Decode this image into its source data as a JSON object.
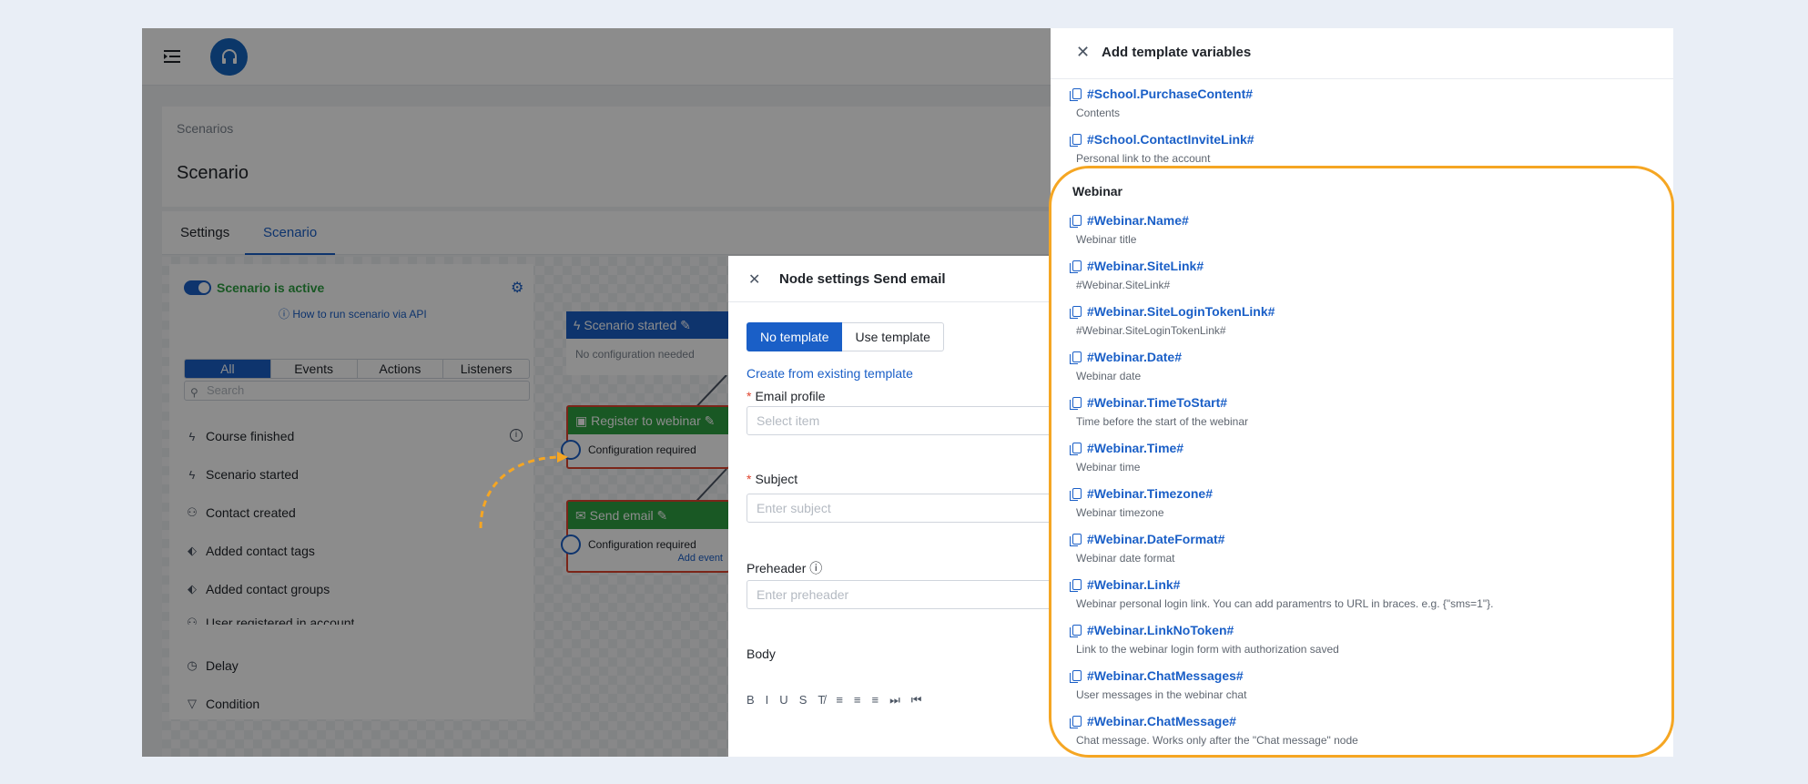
{
  "breadcrumb": "Scenarios",
  "page_title": "Scenario",
  "tabs": [
    {
      "label": "Settings"
    },
    {
      "label": "Scenario"
    }
  ],
  "left_panel": {
    "active_label": "Scenario is active",
    "api_link": "How to run scenario via API",
    "segments": [
      "All",
      "Events",
      "Actions",
      "Listeners"
    ],
    "search_placeholder": "Search",
    "items": [
      {
        "label": "Course finished",
        "icon": "bolt-icon"
      },
      {
        "label": "Scenario started",
        "icon": "bolt-icon"
      },
      {
        "label": "Contact created",
        "icon": "user-icon"
      },
      {
        "label": "Added contact tags",
        "icon": "tag-icon"
      },
      {
        "label": "Added contact groups",
        "icon": "tag-icon"
      },
      {
        "label": "User registered in account",
        "icon": "user-icon"
      },
      {
        "label": "Delay",
        "icon": "clock-icon"
      },
      {
        "label": "Condition",
        "icon": "filter-icon"
      }
    ]
  },
  "nodes": {
    "started": {
      "title": "Scenario started",
      "body": "No configuration needed"
    },
    "register": {
      "title": "Register to webinar",
      "body": "Configuration required"
    },
    "send": {
      "title": "Send email",
      "body": "Configuration required",
      "add_event": "Add event"
    }
  },
  "node_settings": {
    "title": "Node settings Send email",
    "btn_no_template": "No template",
    "btn_use_template": "Use template",
    "create_link": "Create from existing template",
    "email_profile_label": "Email profile",
    "email_profile_placeholder": "Select item",
    "subject_label": "Subject",
    "subject_placeholder": "Enter subject",
    "preheader_label": "Preheader",
    "preheader_placeholder": "Enter preheader",
    "body_label": "Body",
    "toolbar": [
      "B",
      "I",
      "U",
      "S",
      "T̸",
      "≡",
      "≡",
      "≡",
      "⏭",
      "⏮"
    ]
  },
  "drawer": {
    "title": "Add template variables",
    "top_vars": [
      {
        "name": "#School.PurchaseContent#",
        "desc": "Contents"
      },
      {
        "name": "#School.ContactInviteLink#",
        "desc": "Personal link to the account"
      }
    ],
    "section": "Webinar",
    "webinar_vars": [
      {
        "name": "#Webinar.Name#",
        "desc": "Webinar title"
      },
      {
        "name": "#Webinar.SiteLink#",
        "desc": "#Webinar.SiteLink#"
      },
      {
        "name": "#Webinar.SiteLoginTokenLink#",
        "desc": "#Webinar.SiteLoginTokenLink#"
      },
      {
        "name": "#Webinar.Date#",
        "desc": "Webinar date"
      },
      {
        "name": "#Webinar.TimeToStart#",
        "desc": "Time before the start of the webinar"
      },
      {
        "name": "#Webinar.Time#",
        "desc": "Webinar time"
      },
      {
        "name": "#Webinar.Timezone#",
        "desc": "Webinar timezone"
      },
      {
        "name": "#Webinar.DateFormat#",
        "desc": "Webinar date format"
      },
      {
        "name": "#Webinar.Link#",
        "desc": "Webinar personal login link. You can add paramentrs to URL in braces. e.g. {\"sms=1\"}."
      },
      {
        "name": "#Webinar.LinkNoToken#",
        "desc": "Link to the webinar login form with authorization saved"
      },
      {
        "name": "#Webinar.ChatMessages#",
        "desc": "User messages in the webinar chat"
      },
      {
        "name": "#Webinar.ChatMessage#",
        "desc": "Chat message. Works only after the \"Chat message\" node"
      }
    ]
  },
  "colors": {
    "primary": "#1a5fc7",
    "success": "#2ea043",
    "highlight": "#f5a623",
    "error": "#e0442e"
  }
}
